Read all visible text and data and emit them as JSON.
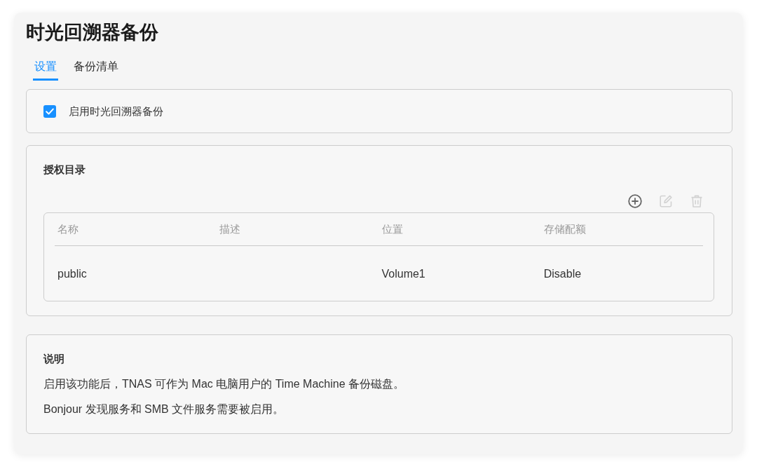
{
  "page": {
    "title": "时光回溯器备份"
  },
  "tabs": [
    {
      "label": "设置",
      "selected": true
    },
    {
      "label": "备份清单",
      "selected": false
    }
  ],
  "enable": {
    "label": "启用时光回溯器备份",
    "checked": true
  },
  "authorized": {
    "heading": "授权目录",
    "toolbar": [
      {
        "kind": "add",
        "disabled": false
      },
      {
        "kind": "edit",
        "disabled": true
      },
      {
        "kind": "delete",
        "disabled": true
      }
    ],
    "table": {
      "columns": [
        "名称",
        "描述",
        "位置",
        "存储配额"
      ],
      "rows": [
        {
          "cells": [
            "public",
            null,
            "Volume1",
            "Disable"
          ]
        }
      ]
    }
  },
  "notes": {
    "heading": "说明",
    "lines": [
      "启用该功能后，TNAS 可作为 Mac 电脑用户的 Time Machine 备份磁盘。",
      "Bonjour 发现服务和 SMB 文件服务需要被启用。"
    ]
  }
}
